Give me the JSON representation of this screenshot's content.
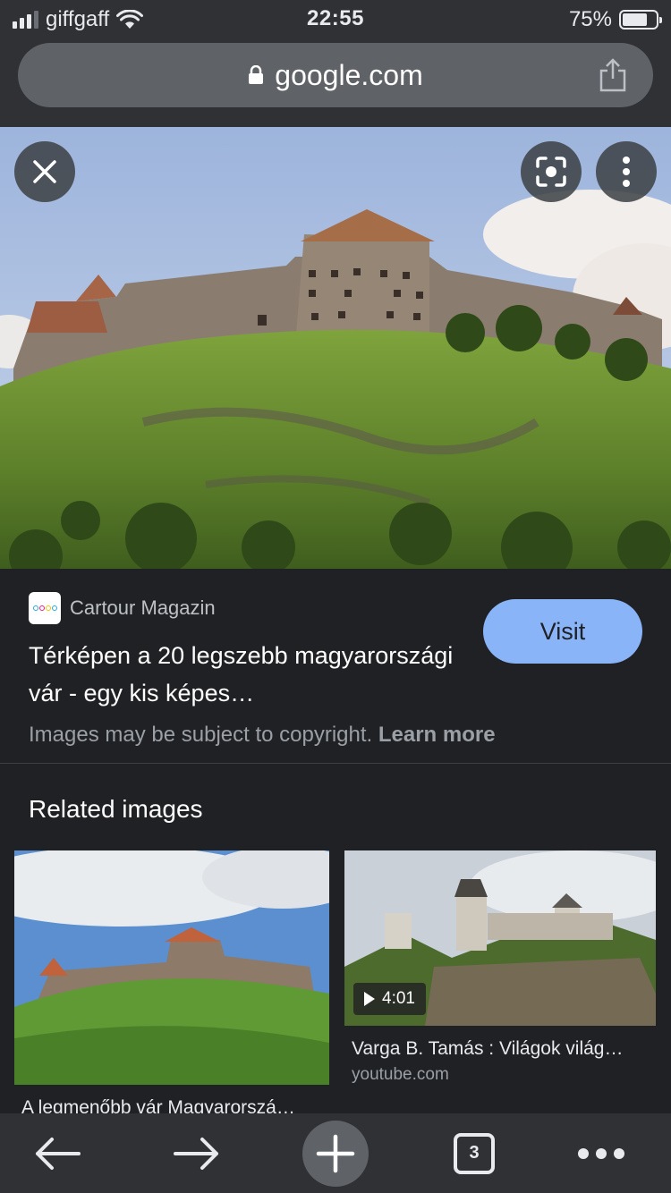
{
  "status_bar": {
    "carrier": "giffgaff",
    "time": "22:55",
    "battery_percent": "75%",
    "battery_level": 0.75,
    "signal_bars_filled": 3,
    "signal_bars_total": 4
  },
  "browser": {
    "url": "google.com",
    "share_icon": "share-icon",
    "lock_icon": "lock-icon"
  },
  "image_viewer": {
    "close_icon": "close-icon",
    "lens_icon": "lens-icon",
    "more_icon": "more-vertical-icon"
  },
  "result": {
    "source": "Cartour Magazin",
    "title": "Térképen a 20 legszebb magyarországi vár - egy kis képes…",
    "visit_label": "Visit",
    "copyright_text": "Images may be subject to copyright.",
    "learn_more": "Learn more"
  },
  "related": {
    "heading": "Related images",
    "items": [
      {
        "title": "A legmenőbb vár Magyarorszá…",
        "source": ""
      },
      {
        "title": "Varga B. Tamás : Világok világ…",
        "source": "youtube.com",
        "duration": "4:01"
      }
    ]
  },
  "toolbar": {
    "tab_count": "3",
    "back_icon": "back-arrow-icon",
    "forward_icon": "forward-arrow-icon",
    "new_tab_icon": "plus-icon",
    "menu_icon": "more-horizontal-icon"
  },
  "colors": {
    "background": "#202124",
    "chrome": "#303134",
    "accent": "#8ab4f8"
  }
}
